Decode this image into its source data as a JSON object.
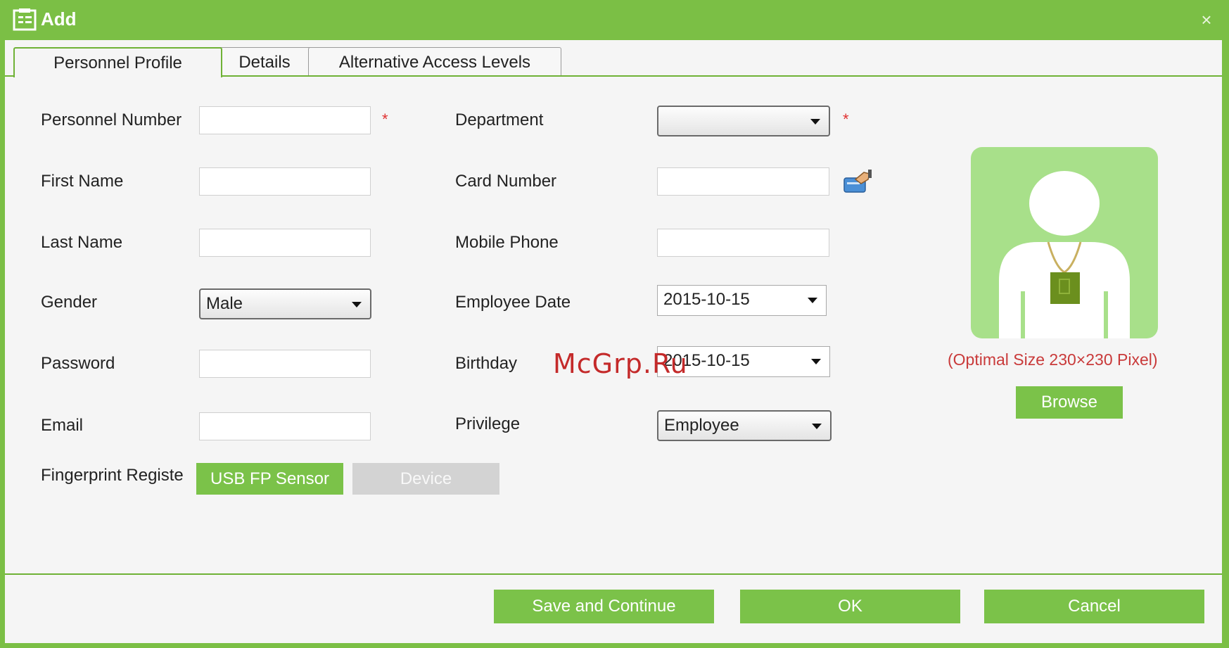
{
  "window": {
    "title": "Add",
    "close_label": "×"
  },
  "tabs": [
    {
      "label": "Personnel  Profile",
      "active": true
    },
    {
      "label": "Details",
      "active": false
    },
    {
      "label": "Alternative  Access  Levels",
      "active": false
    }
  ],
  "form": {
    "personnel_number": {
      "label": "Personnel Number",
      "value": "",
      "required_mark": "*"
    },
    "first_name": {
      "label": "First Name",
      "value": ""
    },
    "last_name": {
      "label": "Last Name",
      "value": ""
    },
    "gender": {
      "label": "Gender",
      "value": "Male"
    },
    "password": {
      "label": "Password",
      "value": ""
    },
    "email": {
      "label": "Email",
      "value": ""
    },
    "fingerprint": {
      "label": "Fingerprint Registe",
      "usb_label": "USB FP Sensor",
      "device_label": "Device"
    },
    "department": {
      "label": "Department",
      "value": "",
      "required_mark": "*"
    },
    "card_number": {
      "label": "Card Number",
      "value": ""
    },
    "mobile_phone": {
      "label": "Mobile Phone",
      "value": ""
    },
    "employee_date": {
      "label": "Employee Date",
      "value": "2015-10-15"
    },
    "birthday": {
      "label": "Birthday",
      "value": "2015-10-15"
    },
    "privilege": {
      "label": "Privilege",
      "value": "Employee"
    }
  },
  "photo": {
    "optimal_text": "(Optimal Size 230×230 Pixel)",
    "browse_label": "Browse"
  },
  "watermark": "McGrp.Ru",
  "footer": {
    "save_continue_label": "Save and Continue",
    "ok_label": "OK",
    "cancel_label": "Cancel"
  },
  "colors": {
    "brand_green": "#7bbf45",
    "button_green": "#7bc249",
    "required_red": "#e03030",
    "hint_red": "#c93a3a",
    "photo_bg": "#a8e08a"
  },
  "icons": {
    "title": "add-window-icon",
    "card_reader": "card-reader-icon",
    "avatar": "person-placeholder-icon"
  }
}
